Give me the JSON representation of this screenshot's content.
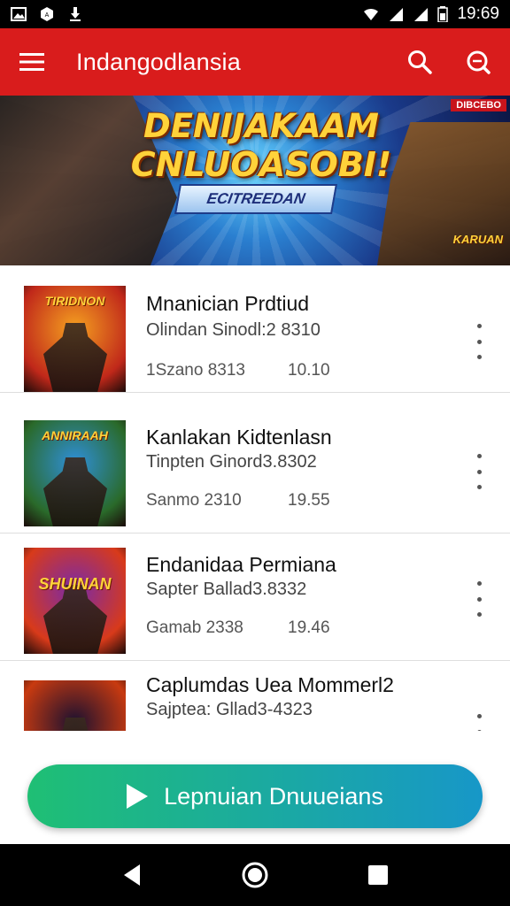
{
  "status_bar": {
    "time": "19:69",
    "icons": [
      "image-icon",
      "notification-icon",
      "download-icon",
      "wifi-icon",
      "signal-icon",
      "signal-icon",
      "battery-icon"
    ]
  },
  "app_bar": {
    "title": "Indangodlansia",
    "icons": [
      "menu-icon",
      "search-icon",
      "search-icon"
    ]
  },
  "banner": {
    "title_line1": "DENIJAKAAM",
    "title_line2": "CNLUOASOBI!",
    "subtitle": "ECITREEDAN",
    "badge": "DIBCEBO",
    "corner_text": "KARUAN"
  },
  "list": {
    "items": [
      {
        "thumb_label": "TIRIDNON",
        "title": "Mnanician Prdtiud",
        "subtitle": "Olindan Sinodl:2  8310",
        "meta_a": "1Szano 8313",
        "meta_b": "10.10",
        "thumb_colors": [
          "#f5a020",
          "#c0281a"
        ]
      },
      {
        "thumb_label": "ANNIRAAH",
        "title": "Kanlakan Kidtenlasn",
        "subtitle": "Tinpten Ginord3.8302",
        "meta_a": "Sanmo 2310",
        "meta_b": "19.55",
        "thumb_colors": [
          "#2f8fd8",
          "#2a6a2a"
        ]
      },
      {
        "thumb_label": "SHUINAN",
        "title": "Endanidaa Permiana",
        "subtitle": "Sapter Ballad3.8332",
        "meta_a": "Gamab 2338",
        "meta_b": "19.46",
        "thumb_colors": [
          "#7a2aa8",
          "#d83a1a"
        ]
      },
      {
        "thumb_label": "",
        "title": "Caplumdas Uea Mommerl2",
        "subtitle": "Sajptea: Gllad3-4323",
        "meta_a": "",
        "meta_b": "",
        "thumb_colors": [
          "#1a1030",
          "#c83a10"
        ]
      }
    ]
  },
  "cta": {
    "label": "Lepnuian Dnuueians",
    "colors": [
      "#1fbf74",
      "#1797c8"
    ]
  },
  "nav_bar": {
    "icons": [
      "back-icon",
      "home-icon",
      "recents-icon"
    ]
  },
  "colors": {
    "app_bar": "#d91c1c",
    "text_primary": "#111111",
    "text_secondary": "#555555"
  }
}
